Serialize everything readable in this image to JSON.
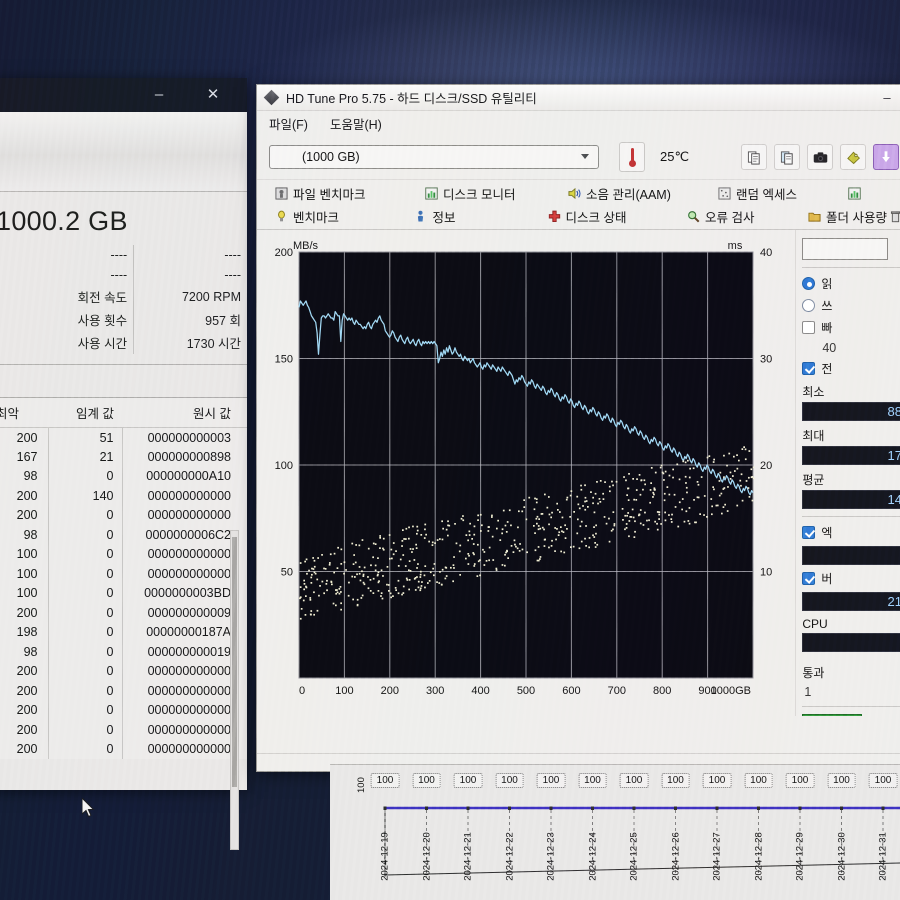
{
  "left_window": {
    "title_buttons": {
      "minimize": "–",
      "close": "✕"
    },
    "capacity": "1000.2 GB",
    "attributes": [
      {
        "label": "----",
        "value": "----"
      },
      {
        "label": "----",
        "value": "----"
      },
      {
        "label": "회전 속도",
        "value": "7200 RPM"
      },
      {
        "label": "사용 횟수",
        "value": "957 회"
      },
      {
        "label": "사용 시간",
        "value": "1730 시간"
      }
    ],
    "smart_headers": {
      "worst": "최악",
      "threshold": "임계 값",
      "raw": "원시 값"
    },
    "smart_rows": [
      {
        "worst": "200",
        "threshold": "51",
        "raw": "000000000003"
      },
      {
        "worst": "167",
        "threshold": "21",
        "raw": "000000000898"
      },
      {
        "worst": "98",
        "threshold": "0",
        "raw": "000000000A10"
      },
      {
        "worst": "200",
        "threshold": "140",
        "raw": "000000000000"
      },
      {
        "worst": "200",
        "threshold": "0",
        "raw": "000000000000"
      },
      {
        "worst": "98",
        "threshold": "0",
        "raw": "0000000006C2"
      },
      {
        "worst": "100",
        "threshold": "0",
        "raw": "000000000000"
      },
      {
        "worst": "100",
        "threshold": "0",
        "raw": "000000000000"
      },
      {
        "worst": "100",
        "threshold": "0",
        "raw": "0000000003BD"
      },
      {
        "worst": "200",
        "threshold": "0",
        "raw": "000000000009"
      },
      {
        "worst": "198",
        "threshold": "0",
        "raw": "00000000187A"
      },
      {
        "worst": "98",
        "threshold": "0",
        "raw": "000000000019"
      },
      {
        "worst": "200",
        "threshold": "0",
        "raw": "000000000000"
      },
      {
        "worst": "200",
        "threshold": "0",
        "raw": "000000000000"
      },
      {
        "worst": "200",
        "threshold": "0",
        "raw": "000000000000"
      },
      {
        "worst": "200",
        "threshold": "0",
        "raw": "000000000000"
      },
      {
        "worst": "200",
        "threshold": "0",
        "raw": "000000000000"
      }
    ]
  },
  "hdtune": {
    "title": "HD Tune Pro 5.75 - 하드 디스크/SSD 유틸리티",
    "minimize_label": "–",
    "menu": [
      {
        "text": "파일(F)",
        "accel": "F"
      },
      {
        "text": "도움말(H)",
        "accel": "H"
      }
    ],
    "drive_value": "(1000 GB)",
    "temperature": "25℃",
    "toolbar_icons": [
      "copy-icon",
      "copy-info-icon",
      "camera-icon",
      "tag-icon",
      "download-icon"
    ],
    "tabs_row1": [
      {
        "label": "파일 벤치마크",
        "icon": "file-benchmark-icon"
      },
      {
        "label": "디스크 모니터",
        "icon": "disk-monitor-icon"
      },
      {
        "label": "소음 관리(AAM)",
        "icon": "sound-icon"
      },
      {
        "label": "랜덤 엑세스",
        "icon": "random-access-icon"
      },
      {
        "label": "",
        "icon": "chart-icon"
      }
    ],
    "tabs_row2": [
      {
        "label": "벤치마크",
        "icon": "benchmark-icon"
      },
      {
        "label": "정보",
        "icon": "info-icon"
      },
      {
        "label": "디스크 상태",
        "icon": "health-icon"
      },
      {
        "label": "오류 검사",
        "icon": "error-scan-icon"
      },
      {
        "label": "폴더 사용량",
        "icon": "folder-icon"
      },
      {
        "label": "",
        "icon": "delete-icon"
      }
    ],
    "right_panel": {
      "read_label": "읽",
      "write_label": "쓰",
      "fast_label": "빠",
      "block_size": "40",
      "transfer_label": "전",
      "min_label": "최소",
      "min_value": "88",
      "max_label": "최대",
      "max_value": "17",
      "avg_label": "평균",
      "avg_value": "14",
      "access_label": "엑",
      "access_value": "",
      "burst_label": "버",
      "burst_value": "21",
      "cpu_label": "CPU ",
      "cpu_value": "",
      "pass_label": "통과 ",
      "pass_value": "1"
    }
  },
  "chart_data": {
    "type": "line",
    "title": "",
    "xlabel": "",
    "ylabel": "MB/s",
    "y2label": "ms",
    "xlim": [
      0,
      1000
    ],
    "ylim": [
      0,
      200
    ],
    "y2lim": [
      0,
      40
    ],
    "xticks": [
      "0",
      "100",
      "200",
      "300",
      "400",
      "500",
      "600",
      "700",
      "800",
      "900",
      "1000GB"
    ],
    "yticks": [
      "50",
      "100",
      "150",
      "200"
    ],
    "y2ticks": [
      "10",
      "20",
      "30",
      "40"
    ],
    "grid": true,
    "series": [
      {
        "name": "transfer-rate",
        "type": "line",
        "color": "#9fd8f5",
        "axis": "left",
        "values": [
          174,
          177,
          176,
          175,
          176,
          177,
          175,
          174,
          172,
          170,
          169,
          168,
          167,
          162,
          152,
          161,
          169,
          170,
          170,
          169,
          170,
          171,
          170,
          169,
          169,
          168,
          172,
          171,
          170,
          170,
          158,
          168,
          171,
          170,
          169,
          168,
          169,
          168,
          169,
          167,
          166,
          168,
          167,
          166,
          166,
          165,
          164,
          165,
          164,
          166,
          167,
          165,
          164,
          166,
          167,
          168,
          167,
          169,
          170,
          168,
          167,
          166,
          163,
          162,
          161,
          160,
          161,
          163,
          162,
          160,
          159,
          158,
          160,
          161,
          159,
          158,
          157,
          159,
          160,
          158,
          157,
          158,
          159,
          157,
          156,
          158,
          159,
          157,
          156,
          158,
          157,
          158,
          157,
          158,
          157,
          158,
          157,
          158,
          157,
          156,
          148,
          150,
          153,
          151,
          154,
          152,
          155,
          153,
          156,
          154,
          152,
          153,
          155,
          153,
          152,
          151,
          152,
          150,
          149,
          151,
          150,
          149,
          150,
          148,
          149,
          150,
          148,
          147,
          146,
          147,
          148,
          146,
          145,
          147,
          146,
          148,
          147,
          146,
          145,
          147,
          146,
          145,
          144,
          146,
          145,
          144,
          146,
          145,
          144,
          143,
          142,
          144,
          143,
          142,
          140,
          138,
          140,
          139,
          141,
          140,
          142,
          141,
          139,
          138,
          137,
          139,
          138,
          140,
          139,
          137,
          136,
          138,
          137,
          136,
          135,
          137,
          136,
          134,
          133,
          135,
          134,
          136,
          135,
          133,
          132,
          134,
          133,
          131,
          130,
          132,
          131,
          133,
          132,
          130,
          129,
          131,
          130,
          128,
          127,
          129,
          128,
          130,
          129,
          127,
          126,
          128,
          127,
          125,
          124,
          126,
          125,
          127,
          126,
          124,
          123,
          125,
          124,
          122,
          121,
          123,
          122,
          124,
          123,
          121,
          120,
          122,
          121,
          119,
          118,
          120,
          119,
          121,
          120,
          118,
          117,
          119,
          118,
          116,
          115,
          117,
          116,
          118,
          117,
          115,
          114,
          116,
          115,
          113,
          112,
          114,
          113,
          111,
          110,
          112,
          111,
          113,
          112,
          110,
          109,
          111,
          110,
          108,
          107,
          109,
          108,
          110,
          109,
          107,
          106,
          108,
          107,
          105,
          104,
          106,
          105,
          103,
          102,
          104,
          103,
          105,
          104,
          102,
          101,
          103,
          102,
          100,
          99,
          101,
          100,
          98,
          97,
          99,
          98,
          100,
          99,
          97,
          96,
          98,
          97,
          95,
          94,
          96,
          95,
          93,
          92,
          94,
          93,
          95,
          94,
          92,
          91,
          93,
          92,
          90,
          89,
          91,
          90,
          88,
          87,
          89,
          88,
          90,
          89,
          87,
          86,
          88,
          87
        ]
      },
      {
        "name": "access-time-scatter",
        "type": "scatter",
        "color": "#f2efd3",
        "axis": "right",
        "note": "Access-time dots scattered roughly 9-23 ms, trending upward across the disk."
      }
    ]
  },
  "timeline": {
    "y_axis_label": "100",
    "badge_value": "100",
    "dates": [
      "2024-12-19",
      "2024-12-20",
      "2024-12-21",
      "2024-12-22",
      "2024-12-23",
      "2024-12-24",
      "2024-12-25",
      "2024-12-26",
      "2024-12-27",
      "2024-12-28",
      "2024-12-29",
      "2024-12-30",
      "2024-12-31"
    ]
  }
}
